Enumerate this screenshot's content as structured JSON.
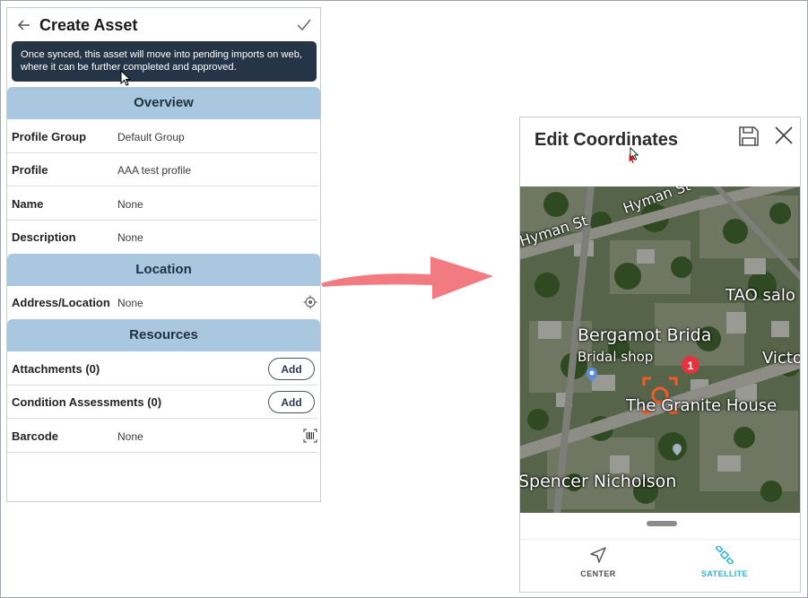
{
  "create_asset": {
    "title": "Create Asset",
    "tooltip": "Once synced, this asset will move into pending imports on web, where it can be further completed and approved.",
    "sections": {
      "overview": "Overview",
      "location": "Location",
      "resources": "Resources"
    },
    "fields": {
      "profile_group": {
        "label": "Profile Group",
        "value": "Default Group"
      },
      "profile": {
        "label": "Profile",
        "value": "AAA test profile"
      },
      "name": {
        "label": "Name",
        "value": "None"
      },
      "description": {
        "label": "Description",
        "value": "None"
      },
      "address": {
        "label": "Address/Location",
        "value": "None"
      },
      "attachments": {
        "label": "Attachments (0)",
        "button": "Add"
      },
      "condition_assessments": {
        "label": "Condition Assessments (0)",
        "button": "Add"
      },
      "barcode": {
        "label": "Barcode",
        "value": "None"
      }
    }
  },
  "edit_coordinates": {
    "title": "Edit Coordinates",
    "map": {
      "labels": {
        "hyman_st_1": "Hyman St",
        "hyman_st_2": "Hyman St",
        "tao": "TAO salo",
        "bergamot": "Bergamot Brida",
        "bridal_shop": "Bridal shop",
        "victo": "Victo",
        "granite": "The Granite House",
        "spencer": "Spencer Nicholson"
      },
      "marker_badge": "1"
    },
    "tabs": {
      "center": "CENTER",
      "satellite": "SATELLITE"
    }
  },
  "colors": {
    "section_band": "#a9c8df",
    "tooltip_bg": "#253447",
    "arrow": "#f27b82",
    "satellite_active": "#2eb3cf",
    "target": "#f25a28"
  }
}
